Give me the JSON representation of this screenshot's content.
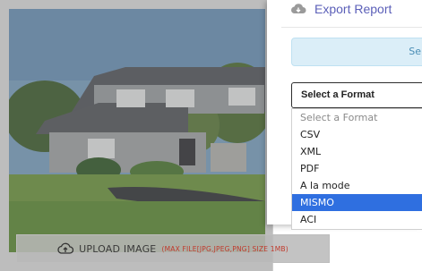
{
  "upload": {
    "label": "UPLOAD IMAGE",
    "hint": "(MAX FILE[JPG,JPEG,PNG] SIZE 1MB)"
  },
  "export": {
    "title": "Export Report",
    "info_text": "Se",
    "select_value": "Select a Format",
    "options": [
      "Select a Format",
      "CSV",
      "XML",
      "PDF",
      "A la mode",
      "MISMO",
      "ACI"
    ],
    "selected_option": "MISMO"
  },
  "colors": {
    "title": "#5b5fb8",
    "selected": "#2f6fe0",
    "info_bg": "#dbeef8",
    "hint": "#c0392b"
  }
}
